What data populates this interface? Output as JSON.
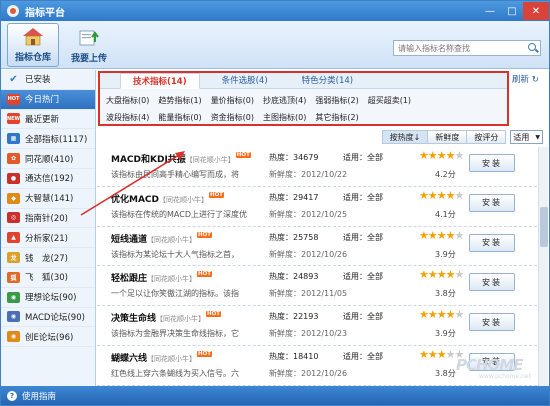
{
  "window": {
    "title": "指标平台"
  },
  "toolbar": {
    "btn1": "指标仓库",
    "btn2": "我要上传"
  },
  "search": {
    "placeholder": "请输入指标名称查找"
  },
  "sidebar": {
    "items": [
      {
        "label": "已安装",
        "icon": "check-icon"
      },
      {
        "label": "今日热门",
        "icon": "hot-icon"
      },
      {
        "label": "最近更新",
        "icon": "new-icon"
      },
      {
        "label": "全部指标(1117)",
        "icon": "grid-icon"
      },
      {
        "label": "同花顺(410)",
        "icon": "flower-icon"
      },
      {
        "label": "通达信(192)",
        "icon": "tdx-icon"
      },
      {
        "label": "大智慧(141)",
        "icon": "dzh-icon"
      },
      {
        "label": "指南针(20)",
        "icon": "compass-icon"
      },
      {
        "label": "分析家(21)",
        "icon": "analyst-icon"
      },
      {
        "label": "钱　龙(27)",
        "icon": "dragon-icon"
      },
      {
        "label": "飞　狐(30)",
        "icon": "fox-icon"
      },
      {
        "label": "理想论坛(90)",
        "icon": "forum-icon"
      },
      {
        "label": "MACD论坛(90)",
        "icon": "macd-forum-icon"
      },
      {
        "label": "创E论坛(96)",
        "icon": "ce-forum-icon"
      }
    ]
  },
  "categories": {
    "tabs": [
      "技术指标(14)",
      "条件选股(4)",
      "特色分类(14)"
    ],
    "refresh": "刷新",
    "items": [
      "大盘指标(0)",
      "趋势指标(1)",
      "量价指标(0)",
      "抄底逃顶(4)",
      "强弱指标(2)",
      "超买超卖(1)",
      "",
      "波段指标(4)",
      "能量指标(0)",
      "资金指标(0)",
      "主图指标(0)",
      "其它指标(2)"
    ]
  },
  "sort": {
    "hot": "按热度↓",
    "new": "新鲜度",
    "score": "按评分",
    "select": "适用"
  },
  "rows": [
    {
      "name": "MACD和KDJ共振",
      "author": "【同花顺小牛】",
      "hot": "HOT",
      "desc": "该指标由民间高手精心编写而成，将",
      "heat": "热度：34679",
      "date": "新鲜度：2012/10/22",
      "apply": "适用：全部",
      "stars": 4,
      "score": "4.2分",
      "install": "安装"
    },
    {
      "name": "优化MACD",
      "author": "【同花顺小牛】",
      "hot": "HOT",
      "desc": "该指标在传统的MACD上进行了深度优",
      "heat": "热度：29417",
      "date": "新鲜度：2012/10/25",
      "apply": "适用：全部",
      "stars": 4,
      "score": "4.1分",
      "install": "安装"
    },
    {
      "name": "短线通道",
      "author": "【同花顺小牛】",
      "hot": "HOT",
      "desc": "该指标为某论坛十大人气指标之首，",
      "heat": "热度：25758",
      "date": "新鲜度：2012/10/26",
      "apply": "适用：全部",
      "stars": 4,
      "score": "3.9分",
      "install": "安装"
    },
    {
      "name": "轻松跟庄",
      "author": "【同花顺小牛】",
      "hot": "HOT",
      "desc": "一个足以让你笑傲江湖的指标。该指",
      "heat": "热度：24893",
      "date": "新鲜度：2012/11/05",
      "apply": "适用：全部",
      "stars": 4,
      "score": "3.8分",
      "install": "安装"
    },
    {
      "name": "决策生命线",
      "author": "【同花顺小牛】",
      "hot": "HOT",
      "desc": "该指标为金融界决策生命线指标，它",
      "heat": "热度：22193",
      "date": "新鲜度：2012/10/23",
      "apply": "适用：全部",
      "stars": 4,
      "score": "3.9分",
      "install": "安装"
    },
    {
      "name": "蝴蝶六线",
      "author": "【同花顺小牛】",
      "hot": "HOT",
      "desc": "红色线上穿六条蝴线为买入信号。六",
      "heat": "热度：18410",
      "date": "新鲜度：2012/10/26",
      "apply": "适用：全部",
      "stars": 3,
      "score": "3.8分",
      "install": "安装"
    }
  ],
  "status": {
    "help": "使用指南"
  },
  "watermark": {
    "line1": "PCHOME",
    "line2": "www.pchome.net"
  },
  "colors": {
    "accent": "#2f78c8",
    "highlight": "#d8322c",
    "star": "#f2a100"
  }
}
